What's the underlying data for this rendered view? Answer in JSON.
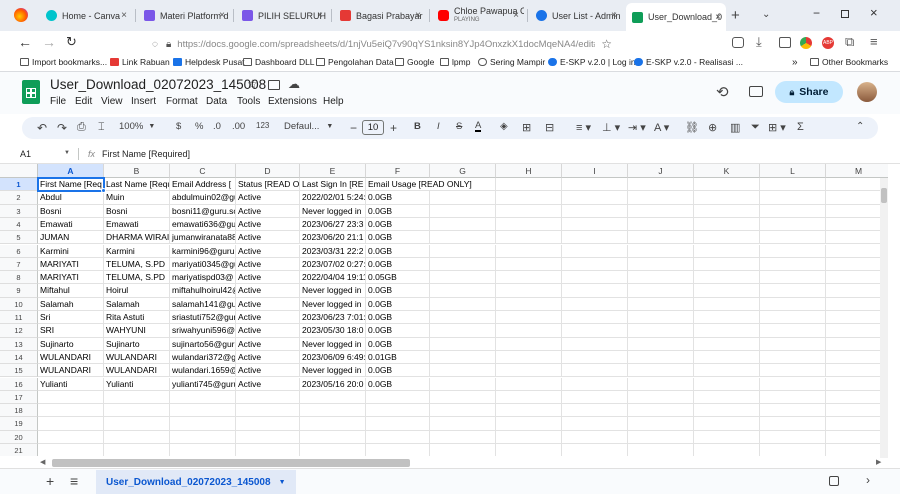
{
  "browser": {
    "tabs": [
      {
        "label": "Home - Canva",
        "color": "#7d2ae8"
      },
      {
        "label": "Materi Platform d",
        "color": "#7b57e8"
      },
      {
        "label": "PILIH SELURUH K",
        "color": "#7b57e8"
      },
      {
        "label": "Bagasi Prabayar",
        "color": "#e53935"
      },
      {
        "label": "Chloe Pawapua C",
        "sublabel": "PLAYING",
        "color": "#ff0000"
      },
      {
        "label": "User List - Admin",
        "color": "#1a73e8"
      },
      {
        "label": "User_Download_0",
        "color": "#0f9d58"
      }
    ],
    "url": "https://docs.google.com/spreadsheets/d/1njVu5eiQ7v90qYS1nksin8YJp4OnxzkX1docMqeNA4/edit#gid=135",
    "bookmarks": [
      "Import bookmarks...",
      "Link Rabuan",
      "Helpdesk Pusat",
      "Dashboard DLL",
      "Pengolahan Data",
      "Google",
      "lpmp",
      "Sering Mampir",
      "E-SKP v.2.0 | Log in",
      "E-SKP v.2.0 - Realisasi ..."
    ],
    "other_bookmarks": "Other Bookmarks",
    "more": "»"
  },
  "sheets": {
    "title": "User_Download_02072023_145008",
    "menus": [
      "File",
      "Edit",
      "View",
      "Insert",
      "Format",
      "Data",
      "Tools",
      "Extensions",
      "Help"
    ],
    "share_label": "Share",
    "toolbar": {
      "zoom": "100%",
      "currency": "$",
      "percent": "%",
      "dec_decrease": ".0",
      "dec_increase": ".00",
      "number_format": "123",
      "font": "Defaul...",
      "font_size": "10",
      "minus": "−",
      "plus": "+",
      "bold": "B",
      "italic": "I",
      "strike": "S",
      "text_color": "A",
      "sum": "Σ"
    },
    "name_box": "A1",
    "formula": "First Name [Required]",
    "columns": [
      "A",
      "B",
      "C",
      "D",
      "E",
      "F",
      "G",
      "H",
      "I",
      "J",
      "K",
      "L",
      "M"
    ],
    "rows": [
      [
        "First Name [Req",
        "Last Name [Requ",
        "Email Address [",
        "Status [READ O",
        "Last Sign In [RE",
        "Email Usage [READ ONLY]"
      ],
      [
        "Abdul",
        "Muin",
        "abdulmuin02@gu",
        "Active",
        "2022/02/01 5:24:",
        "0.0GB"
      ],
      [
        "Bosni",
        "Bosni",
        "bosni11@guru.sc",
        "Active",
        "Never logged in",
        "0.0GB"
      ],
      [
        "Emawati",
        "Emawati",
        "emawati636@gu",
        "Active",
        "2023/06/27 23:3",
        "0.0GB"
      ],
      [
        "JUMAN",
        "DHARMA WIRAI",
        "jumanwiranata88",
        "Active",
        "2023/06/20 21:1",
        "0.0GB"
      ],
      [
        "Karmini",
        "Karmini",
        "karmini96@guru.",
        "Active",
        "2023/03/31 22:2",
        "0.0GB"
      ],
      [
        "MARIYATI",
        "TELUMA, S.PD",
        "mariyati0345@gu",
        "Active",
        "2023/07/02 0:27:",
        "0.0GB"
      ],
      [
        "MARIYATI",
        "TELUMA, S.PD",
        "mariyatispd03@",
        "Active",
        "2022/04/04 19:11",
        "0.05GB"
      ],
      [
        "Miftahul",
        "Hoirul",
        "miftahulhoirul42@",
        "Active",
        "Never logged in",
        "0.0GB"
      ],
      [
        "Salamah",
        "Salamah",
        "salamah141@gu",
        "Active",
        "Never logged in",
        "0.0GB"
      ],
      [
        "Sri",
        "Rita Astuti",
        "sriastuti752@gur",
        "Active",
        "2023/06/23 7:01:",
        "0.0GB"
      ],
      [
        "SRI",
        "WAHYUNI",
        "sriwahyuni596@",
        "Active",
        "2023/05/30 18:0",
        "0.0GB"
      ],
      [
        "Sujinarto",
        "Sujinarto",
        "sujinarto56@guru",
        "Active",
        "Never logged in",
        "0.0GB"
      ],
      [
        "WULANDARI",
        "WULANDARI",
        "wulandari372@g",
        "Active",
        "2023/06/09 6:49:",
        "0.01GB"
      ],
      [
        "WULANDARI",
        "WULANDARI",
        "wulandari.1659@",
        "Active",
        "Never logged in",
        "0.0GB"
      ],
      [
        "Yulianti",
        "Yulianti",
        "yulianti745@guru",
        "Active",
        "2023/05/16 20:0",
        "0.0GB"
      ],
      [
        "",
        "",
        "",
        "",
        "",
        ""
      ],
      [
        "",
        "",
        "",
        "",
        "",
        ""
      ],
      [
        "",
        "",
        "",
        "",
        "",
        ""
      ],
      [
        "",
        "",
        "",
        "",
        "",
        ""
      ],
      [
        "",
        "",
        "",
        "",
        "",
        ""
      ]
    ],
    "row_numbers": [
      "1",
      "2",
      "3",
      "4",
      "5",
      "6",
      "7",
      "8",
      "9",
      "10",
      "11",
      "12",
      "13",
      "14",
      "15",
      "16",
      "17",
      "18",
      "19",
      "20",
      "21"
    ],
    "sheet_tab": "User_Download_02072023_145008",
    "add_sheet": "+",
    "sheets_menu": "≡"
  }
}
